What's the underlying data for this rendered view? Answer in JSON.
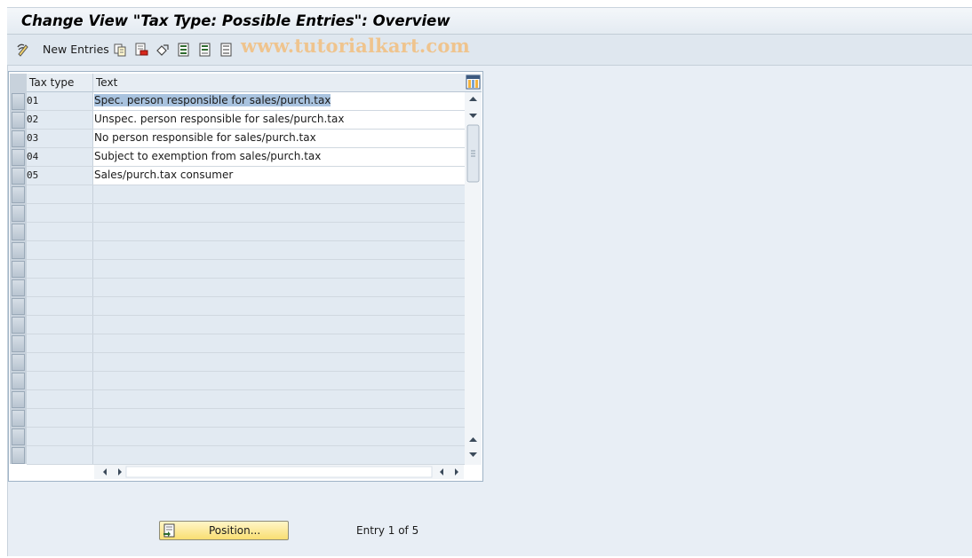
{
  "window": {
    "title": "Change View \"Tax Type: Possible Entries\": Overview"
  },
  "toolbar": {
    "new_entries_label": "New Entries",
    "icons": [
      "display-change-icon",
      "copy-icon",
      "delete-icon",
      "undo-icon",
      "select-all-icon",
      "select-block-icon",
      "deselect-all-icon"
    ],
    "watermark": "www.tutorialkart.com"
  },
  "table": {
    "columns": [
      "Tax type",
      "Text"
    ],
    "rows": [
      {
        "code": "01",
        "text": "Spec. person responsible for sales/purch.tax"
      },
      {
        "code": "02",
        "text": "Unspec. person responsible for sales/purch.tax"
      },
      {
        "code": "03",
        "text": "No person responsible for sales/purch.tax"
      },
      {
        "code": "04",
        "text": "Subject to exemption from sales/purch.tax"
      },
      {
        "code": "05",
        "text": "Sales/purch.tax consumer"
      }
    ],
    "highlighted_row": 0
  },
  "footer": {
    "position_label": "Position...",
    "entry_info": "Entry 1 of 5"
  },
  "colors": {
    "title_bg": "#e4ebf2",
    "toolbar_bg": "#dfe7ef",
    "content_bg": "#e8eef5",
    "button_bg": "#f9de72",
    "selection": "#a9c3df"
  }
}
